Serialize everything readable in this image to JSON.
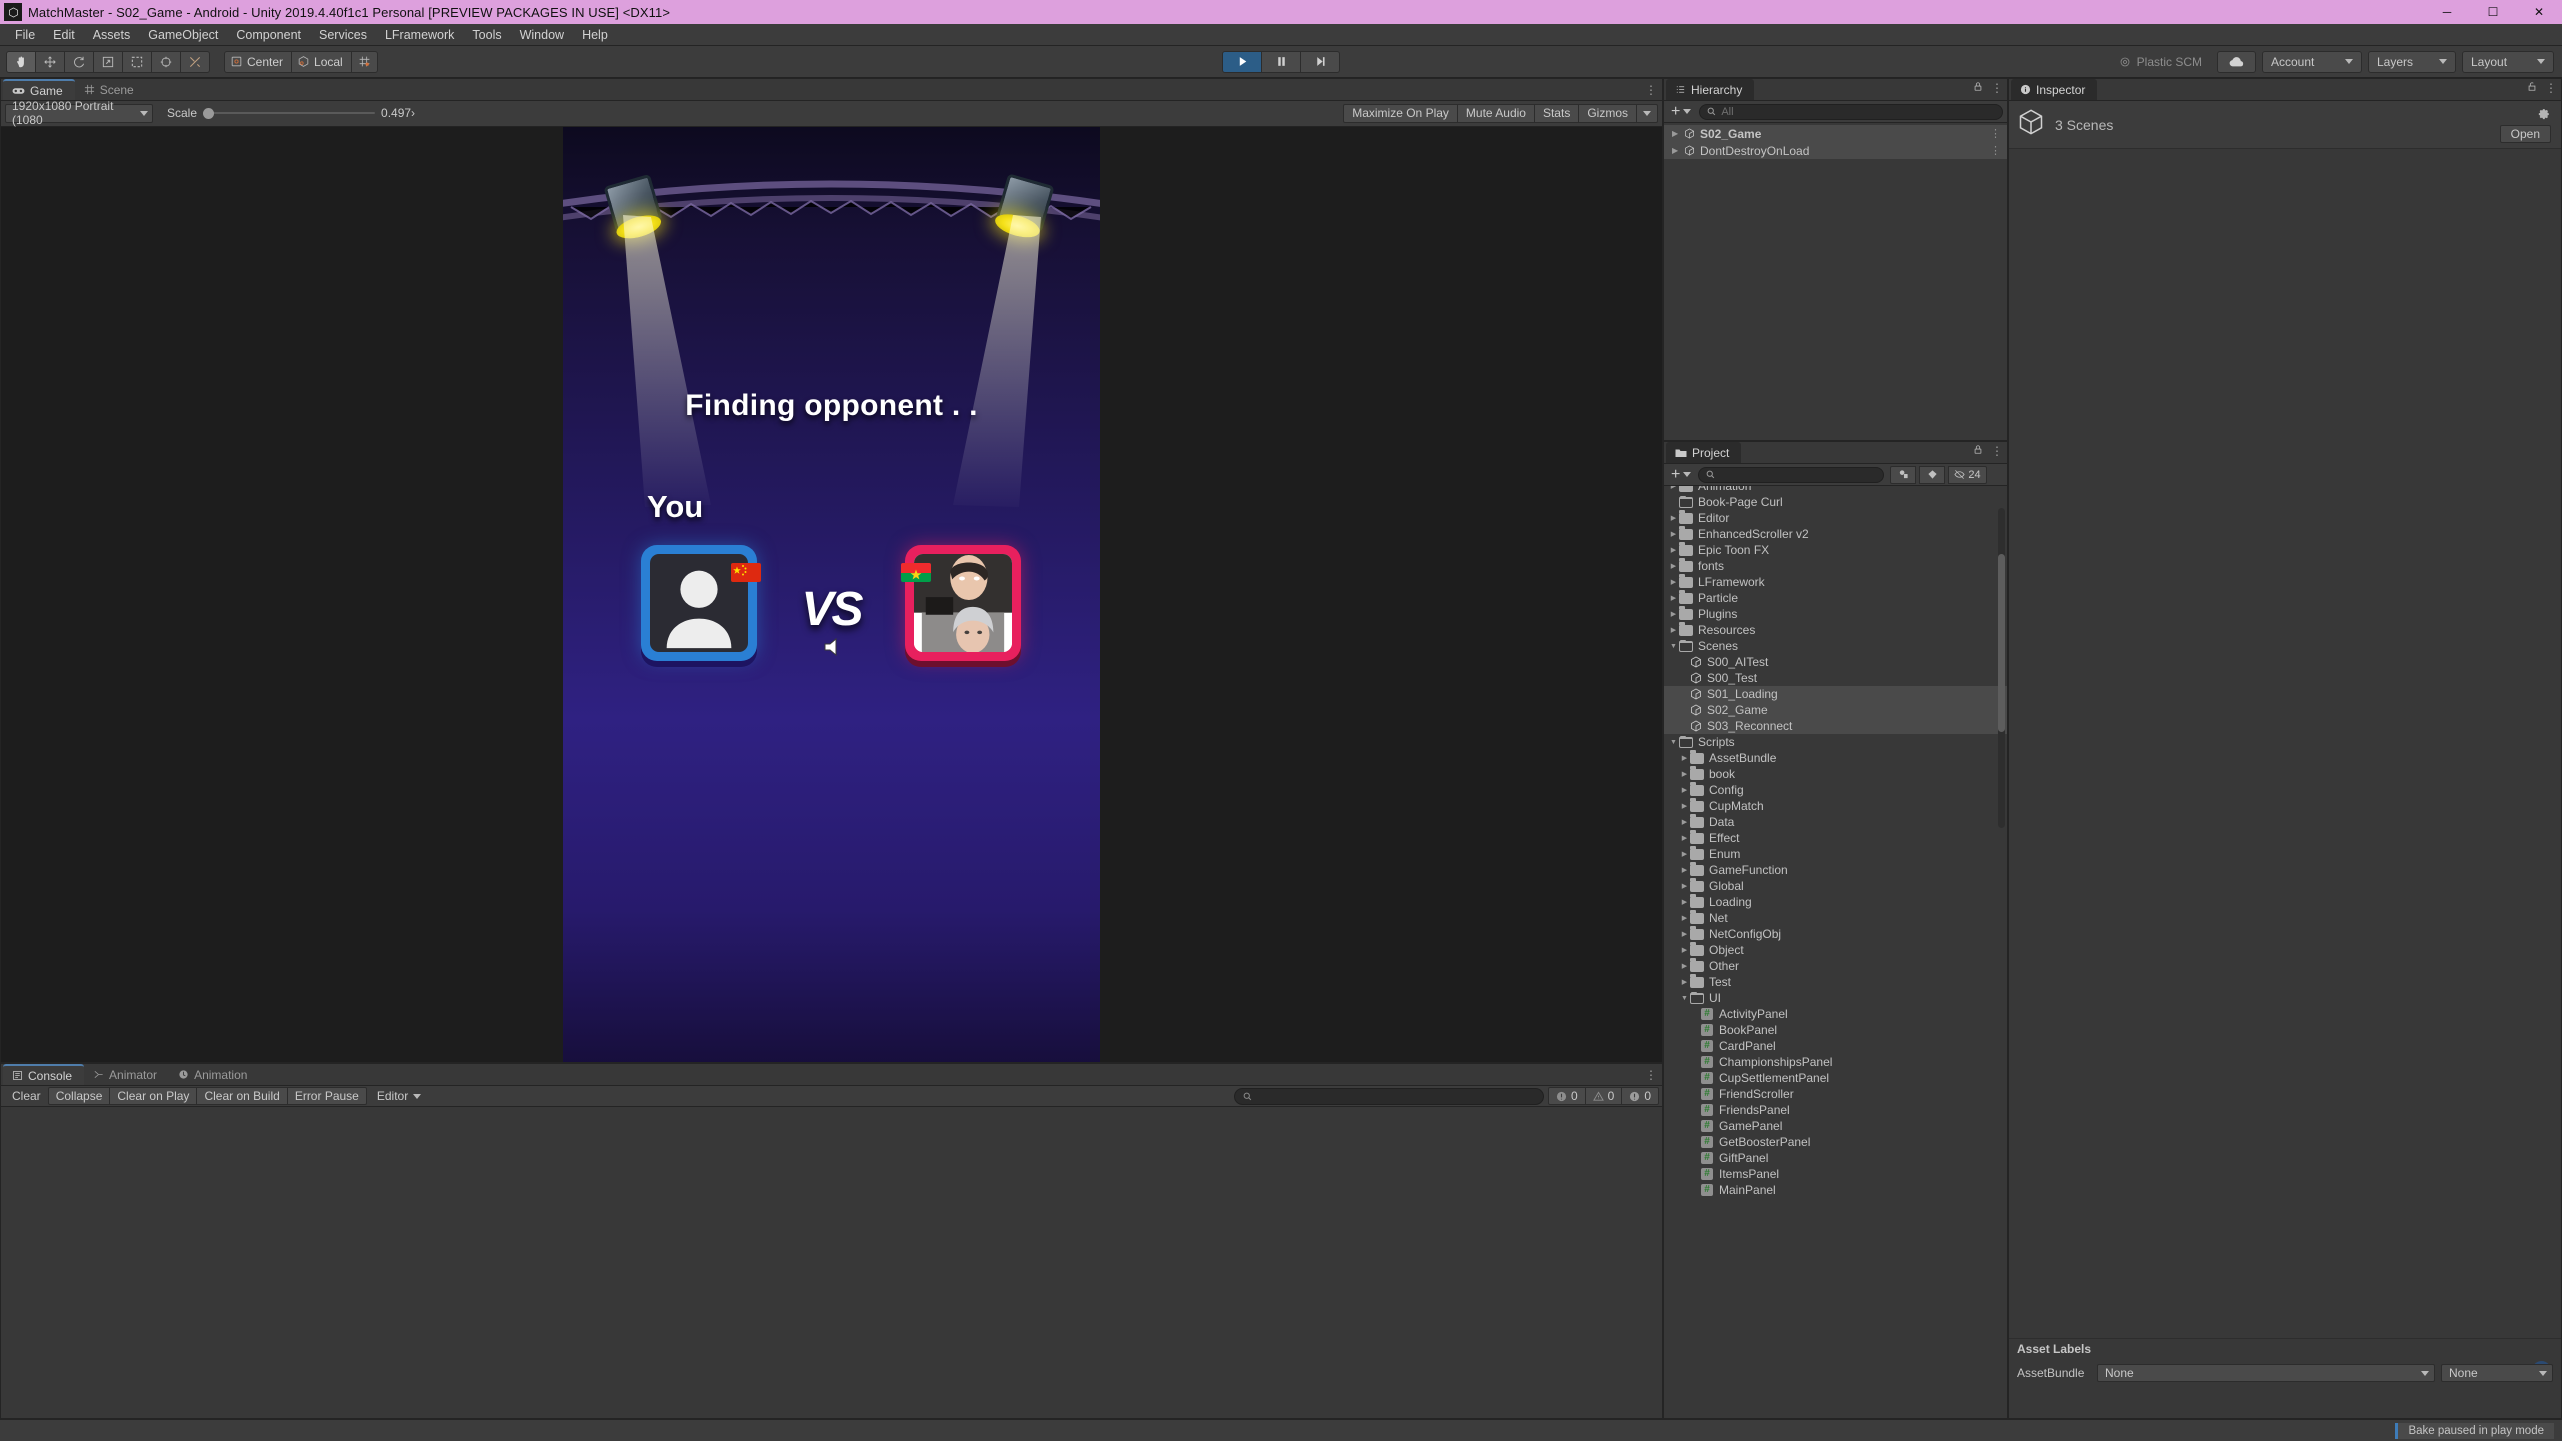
{
  "window": {
    "title": "MatchMaster - S02_Game - Android - Unity 2019.4.40f1c1 Personal [PREVIEW PACKAGES IN USE] <DX11>",
    "app_icon": "unity-icon",
    "minimize": "─",
    "maximize": "☐",
    "close": "✕"
  },
  "menubar": {
    "items": [
      "File",
      "Edit",
      "Assets",
      "GameObject",
      "Component",
      "Services",
      "LFramework",
      "Tools",
      "Window",
      "Help"
    ]
  },
  "toolbar": {
    "tools": [
      {
        "name": "hand-tool",
        "active": true
      },
      {
        "name": "move-tool",
        "active": false
      },
      {
        "name": "rotate-tool",
        "active": false
      },
      {
        "name": "scale-tool",
        "active": false
      },
      {
        "name": "rect-tool",
        "active": false
      },
      {
        "name": "transform-tool",
        "active": false
      },
      {
        "name": "custom-editor-tool",
        "active": false
      }
    ],
    "pivot_label": "Center",
    "space_label": "Local",
    "grid_label": "grid-snap-icon",
    "play": "▶",
    "pause": "⏸",
    "step": "⏭",
    "play_active": true,
    "collab_label": "Plastic SCM",
    "cloud_label": "cloud-icon",
    "account_label": "Account",
    "layers_label": "Layers",
    "layout_label": "Layout"
  },
  "game_panel": {
    "tabs": [
      {
        "label": "Game",
        "icon": "gamepad-icon",
        "active": true
      },
      {
        "label": "Scene",
        "icon": "grid-icon",
        "active": false
      }
    ],
    "resolution": "1920x1080 Portrait (1080",
    "scale_label": "Scale",
    "scale_value": "0.497›",
    "maximize_on_play": "Maximize On Play",
    "mute_audio": "Mute Audio",
    "stats": "Stats",
    "gizmos": "Gizmos"
  },
  "game_screen": {
    "finding_text": "Finding opponent . .",
    "you_label": "You",
    "vs_label": "VS",
    "player_left": {
      "avatar": "default-person-avatar",
      "border_color": "#2a7fd4",
      "flag": "china-flag"
    },
    "player_right": {
      "avatar": "opponent-photo",
      "border_color": "#e8205e",
      "flag": "burkina-faso-flag"
    },
    "mute_icon": "speaker-mute-icon"
  },
  "console_panel": {
    "tabs": [
      {
        "label": "Console",
        "icon": "console-icon",
        "active": true
      },
      {
        "label": "Animator",
        "icon": "animator-icon",
        "active": false
      },
      {
        "label": "Animation",
        "icon": "animation-icon",
        "active": false
      }
    ],
    "buttons": [
      "Clear",
      "Collapse",
      "Clear on Play",
      "Clear on Build",
      "Error Pause"
    ],
    "editor_dropdown": "Editor",
    "search_placeholder": "",
    "counts": {
      "log": "0",
      "warning": "0",
      "error": "0"
    }
  },
  "hierarchy_panel": {
    "tab_label": "Hierarchy",
    "search_placeholder": "All",
    "items": [
      {
        "label": "S02_Game",
        "selected": true,
        "expandable": true
      },
      {
        "label": "DontDestroyOnLoad",
        "selected": true,
        "expandable": true
      }
    ]
  },
  "project_panel": {
    "tab_label": "Project",
    "search_placeholder": "",
    "count_badge": "24",
    "tree": [
      {
        "label": "Animation",
        "depth": 1,
        "type": "folder",
        "state": "collapsed",
        "clipped": true
      },
      {
        "label": "Book-Page Curl",
        "depth": 1,
        "type": "folder-empty",
        "state": "none"
      },
      {
        "label": "Editor",
        "depth": 1,
        "type": "folder",
        "state": "collapsed"
      },
      {
        "label": "EnhancedScroller v2",
        "depth": 1,
        "type": "folder",
        "state": "collapsed"
      },
      {
        "label": "Epic Toon FX",
        "depth": 1,
        "type": "folder",
        "state": "collapsed"
      },
      {
        "label": "fonts",
        "depth": 1,
        "type": "folder",
        "state": "collapsed"
      },
      {
        "label": "LFramework",
        "depth": 1,
        "type": "folder",
        "state": "collapsed"
      },
      {
        "label": "Particle",
        "depth": 1,
        "type": "folder",
        "state": "collapsed"
      },
      {
        "label": "Plugins",
        "depth": 1,
        "type": "folder",
        "state": "collapsed"
      },
      {
        "label": "Resources",
        "depth": 1,
        "type": "folder",
        "state": "collapsed"
      },
      {
        "label": "Scenes",
        "depth": 1,
        "type": "folder",
        "state": "expanded"
      },
      {
        "label": "S00_AITest",
        "depth": 2,
        "type": "scene",
        "state": "none"
      },
      {
        "label": "S00_Test",
        "depth": 2,
        "type": "scene",
        "state": "none"
      },
      {
        "label": "S01_Loading",
        "depth": 2,
        "type": "scene",
        "state": "none",
        "selected": true
      },
      {
        "label": "S02_Game",
        "depth": 2,
        "type": "scene",
        "state": "none",
        "selected": true
      },
      {
        "label": "S03_Reconnect",
        "depth": 2,
        "type": "scene",
        "state": "none",
        "selected": true
      },
      {
        "label": "Scripts",
        "depth": 1,
        "type": "folder",
        "state": "expanded"
      },
      {
        "label": "AssetBundle",
        "depth": 2,
        "type": "folder",
        "state": "collapsed"
      },
      {
        "label": "book",
        "depth": 2,
        "type": "folder",
        "state": "collapsed"
      },
      {
        "label": "Config",
        "depth": 2,
        "type": "folder",
        "state": "collapsed"
      },
      {
        "label": "CupMatch",
        "depth": 2,
        "type": "folder",
        "state": "collapsed"
      },
      {
        "label": "Data",
        "depth": 2,
        "type": "folder",
        "state": "collapsed"
      },
      {
        "label": "Effect",
        "depth": 2,
        "type": "folder",
        "state": "collapsed"
      },
      {
        "label": "Enum",
        "depth": 2,
        "type": "folder",
        "state": "collapsed"
      },
      {
        "label": "GameFunction",
        "depth": 2,
        "type": "folder",
        "state": "collapsed"
      },
      {
        "label": "Global",
        "depth": 2,
        "type": "folder",
        "state": "collapsed"
      },
      {
        "label": "Loading",
        "depth": 2,
        "type": "folder",
        "state": "collapsed"
      },
      {
        "label": "Net",
        "depth": 2,
        "type": "folder",
        "state": "collapsed"
      },
      {
        "label": "NetConfigObj",
        "depth": 2,
        "type": "folder",
        "state": "collapsed"
      },
      {
        "label": "Object",
        "depth": 2,
        "type": "folder",
        "state": "collapsed"
      },
      {
        "label": "Other",
        "depth": 2,
        "type": "folder",
        "state": "collapsed"
      },
      {
        "label": "Test",
        "depth": 2,
        "type": "folder",
        "state": "collapsed"
      },
      {
        "label": "UI",
        "depth": 2,
        "type": "folder",
        "state": "expanded"
      },
      {
        "label": "ActivityPanel",
        "depth": 3,
        "type": "script",
        "state": "none"
      },
      {
        "label": "BookPanel",
        "depth": 3,
        "type": "script",
        "state": "none"
      },
      {
        "label": "CardPanel",
        "depth": 3,
        "type": "script",
        "state": "none"
      },
      {
        "label": "ChampionshipsPanel",
        "depth": 3,
        "type": "script",
        "state": "none"
      },
      {
        "label": "CupSettlementPanel",
        "depth": 3,
        "type": "script",
        "state": "none"
      },
      {
        "label": "FriendScroller",
        "depth": 3,
        "type": "script",
        "state": "none"
      },
      {
        "label": "FriendsPanel",
        "depth": 3,
        "type": "script",
        "state": "none"
      },
      {
        "label": "GamePanel",
        "depth": 3,
        "type": "script",
        "state": "none"
      },
      {
        "label": "GetBoosterPanel",
        "depth": 3,
        "type": "script",
        "state": "none"
      },
      {
        "label": "GiftPanel",
        "depth": 3,
        "type": "script",
        "state": "none"
      },
      {
        "label": "ItemsPanel",
        "depth": 3,
        "type": "script",
        "state": "none"
      },
      {
        "label": "MainPanel",
        "depth": 3,
        "type": "script",
        "state": "none"
      }
    ]
  },
  "inspector_panel": {
    "tab_label": "Inspector",
    "title": "3 Scenes",
    "open_button": "Open",
    "asset_labels_title": "Asset Labels",
    "assetbundle_label": "AssetBundle",
    "assetbundle_value": "None",
    "assetvariant_value": "None"
  },
  "statusbar": {
    "message": "Bake paused in play mode"
  }
}
